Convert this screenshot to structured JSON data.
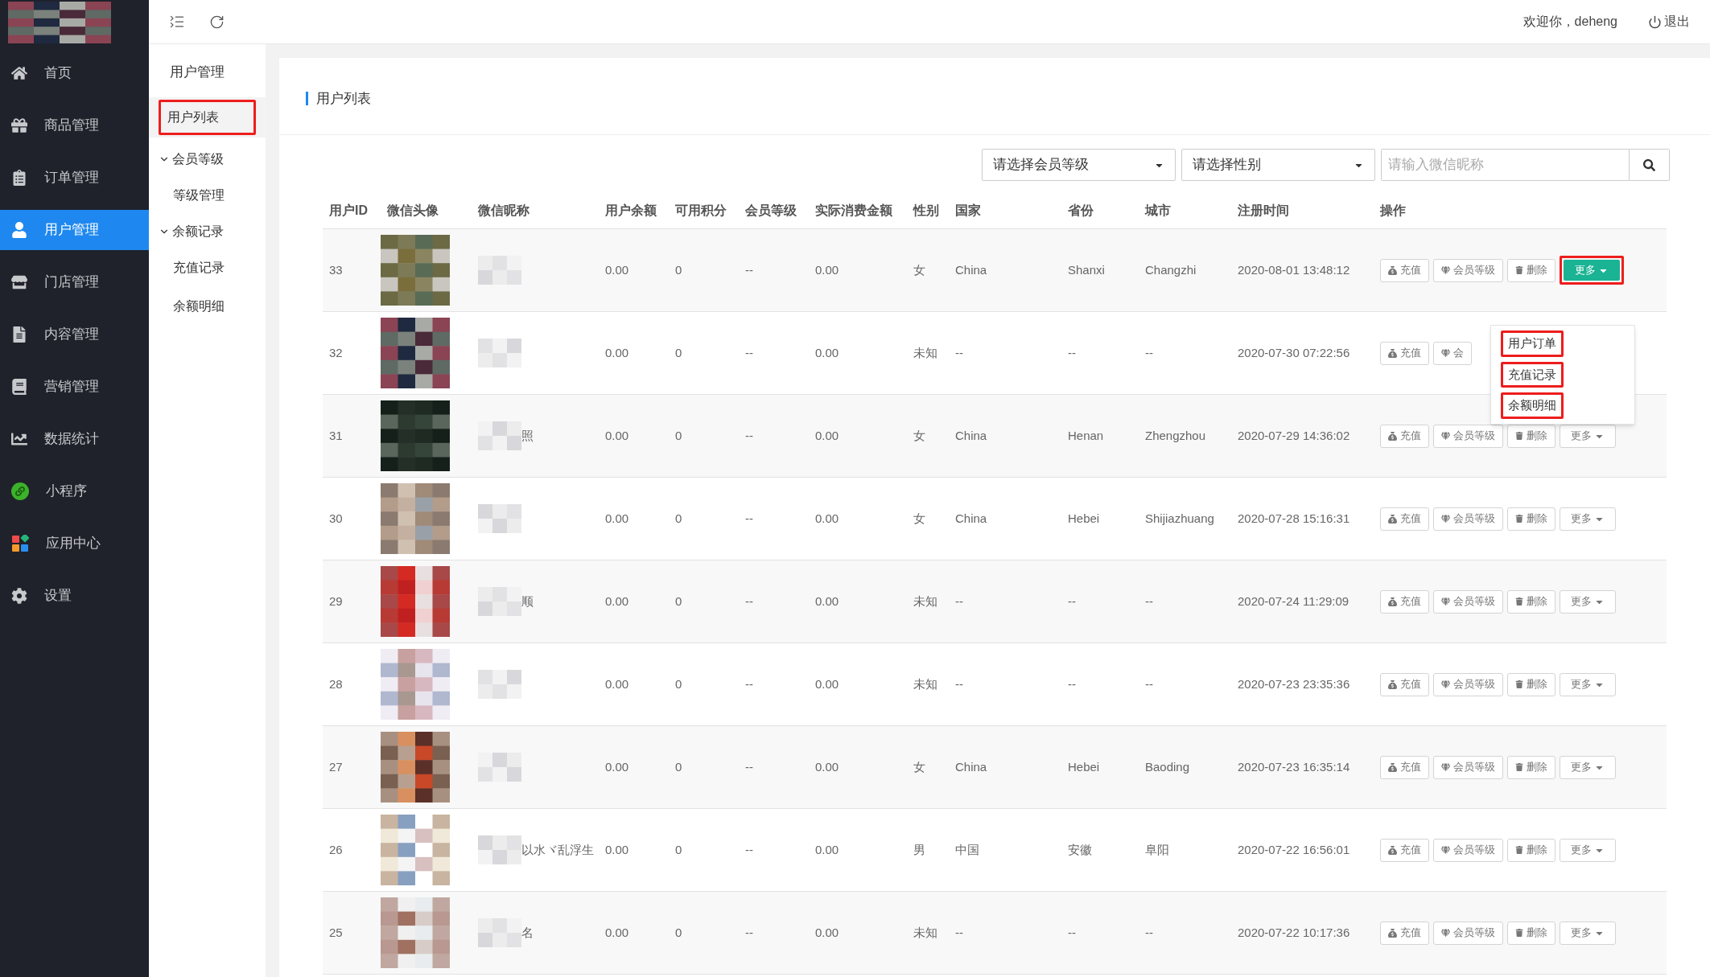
{
  "topbar": {
    "greeting": "欢迎你，deheng",
    "logout": "退出"
  },
  "sidebar": {
    "items": [
      {
        "label": "首页",
        "selected": false
      },
      {
        "label": "商品管理",
        "selected": false
      },
      {
        "label": "订单管理",
        "selected": false
      },
      {
        "label": "用户管理",
        "selected": true
      },
      {
        "label": "门店管理",
        "selected": false
      },
      {
        "label": "内容管理",
        "selected": false
      },
      {
        "label": "营销管理",
        "selected": false
      },
      {
        "label": "数据统计",
        "selected": false
      },
      {
        "label": "小程序",
        "selected": false
      },
      {
        "label": "应用中心",
        "selected": false
      },
      {
        "label": "设置",
        "selected": false
      }
    ]
  },
  "subnav": {
    "title": "用户管理",
    "items": [
      {
        "kind": "link",
        "label": "用户列表",
        "selected": true
      },
      {
        "kind": "group",
        "label": "会员等级",
        "expanded": true,
        "children": [
          {
            "label": "等级管理",
            "selected": false
          }
        ]
      },
      {
        "kind": "group",
        "label": "余额记录",
        "expanded": true,
        "children": [
          {
            "label": "充值记录",
            "selected": false
          },
          {
            "label": "余额明细",
            "selected": false
          }
        ]
      }
    ]
  },
  "card": {
    "title": "用户列表"
  },
  "filters": {
    "level_select": "请选择会员等级",
    "gender_select": "请选择性别",
    "search": {
      "placeholder": "请输入微信昵称"
    }
  },
  "table": {
    "columns": [
      "用户ID",
      "微信头像",
      "微信昵称",
      "用户余额",
      "可用积分",
      "会员等级",
      "实际消费金额",
      "性别",
      "国家",
      "省份",
      "城市",
      "注册时间",
      "操作"
    ],
    "rows": [
      {
        "id": "33",
        "nickname": "",
        "balance": "0.00",
        "points": "0",
        "level": "--",
        "spent": "0.00",
        "gender": "女",
        "country": "China",
        "province": "Shanxi",
        "city": "Changzhi",
        "registered": "2020-08-01 13:48:12",
        "actions": [
          "充值",
          "会员等级",
          "删除"
        ],
        "more": {
          "label": "更多",
          "open": true
        }
      },
      {
        "id": "32",
        "nickname": "",
        "balance": "0.00",
        "points": "0",
        "level": "--",
        "spent": "0.00",
        "gender": "未知",
        "country": "--",
        "province": "--",
        "city": "--",
        "registered": "2020-07-30 07:22:56",
        "actions": [
          "充值",
          "会"
        ]
      },
      {
        "id": "31",
        "nickname": "照",
        "balance": "0.00",
        "points": "0",
        "level": "--",
        "spent": "0.00",
        "gender": "女",
        "country": "China",
        "province": "Henan",
        "city": "Zhengzhou",
        "registered": "2020-07-29 14:36:02",
        "actions": [
          "充值",
          "会员等级",
          "删除"
        ],
        "more": {
          "label": "更多",
          "open": false
        }
      },
      {
        "id": "30",
        "nickname": "",
        "balance": "0.00",
        "points": "0",
        "level": "--",
        "spent": "0.00",
        "gender": "女",
        "country": "China",
        "province": "Hebei",
        "city": "Shijiazhuang",
        "registered": "2020-07-28 15:16:31",
        "actions": [
          "充值",
          "会员等级",
          "删除"
        ],
        "more": {
          "label": "更多",
          "open": false
        }
      },
      {
        "id": "29",
        "nickname": "顺",
        "balance": "0.00",
        "points": "0",
        "level": "--",
        "spent": "0.00",
        "gender": "未知",
        "country": "--",
        "province": "--",
        "city": "--",
        "registered": "2020-07-24 11:29:09",
        "actions": [
          "充值",
          "会员等级",
          "删除"
        ],
        "more": {
          "label": "更多",
          "open": false
        }
      },
      {
        "id": "28",
        "nickname": "",
        "balance": "0.00",
        "points": "0",
        "level": "--",
        "spent": "0.00",
        "gender": "未知",
        "country": "--",
        "province": "--",
        "city": "--",
        "registered": "2020-07-23 23:35:36",
        "actions": [
          "充值",
          "会员等级",
          "删除"
        ],
        "more": {
          "label": "更多",
          "open": false
        }
      },
      {
        "id": "27",
        "nickname": "",
        "balance": "0.00",
        "points": "0",
        "level": "--",
        "spent": "0.00",
        "gender": "女",
        "country": "China",
        "province": "Hebei",
        "city": "Baoding",
        "registered": "2020-07-23 16:35:14",
        "actions": [
          "充值",
          "会员等级",
          "删除"
        ],
        "more": {
          "label": "更多",
          "open": false
        }
      },
      {
        "id": "26",
        "nickname": "以水ヾ乱浮生",
        "balance": "0.00",
        "points": "0",
        "level": "--",
        "spent": "0.00",
        "gender": "男",
        "country": "中国",
        "province": "安徽",
        "city": "阜阳",
        "registered": "2020-07-22 16:56:01",
        "actions": [
          "充值",
          "会员等级",
          "删除"
        ],
        "more": {
          "label": "更多",
          "open": false
        }
      },
      {
        "id": "25",
        "nickname": "名",
        "balance": "0.00",
        "points": "0",
        "level": "--",
        "spent": "0.00",
        "gender": "未知",
        "country": "--",
        "province": "--",
        "city": "--",
        "registered": "2020-07-22 10:17:36",
        "actions": [
          "充值",
          "会员等级",
          "删除"
        ],
        "more": {
          "label": "更多",
          "open": false
        }
      }
    ]
  },
  "more_menu": {
    "items": [
      "用户订单",
      "充值记录",
      "余额明细"
    ]
  }
}
